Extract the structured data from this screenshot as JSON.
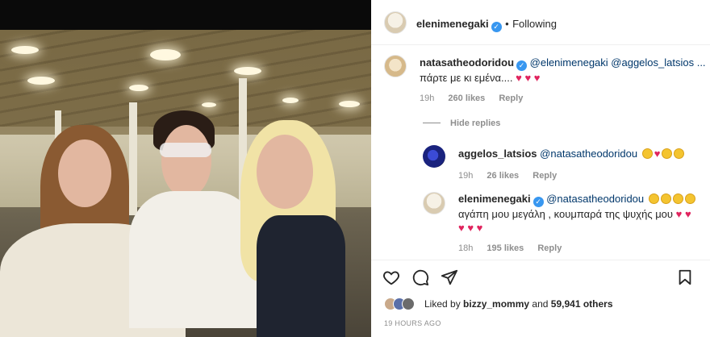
{
  "post": {
    "author": "elenimenegaki",
    "follow_separator": "•",
    "follow_status": "Following"
  },
  "comments": [
    {
      "username": "natasatheodoridou",
      "mentions": "@elenimenegaki @aggelos_latsios ...",
      "text": "πάρτε με κι εμένα....",
      "emoji": "♥ ♥ ♥",
      "time": "19h",
      "likes": "260 likes",
      "reply": "Reply"
    }
  ],
  "hide_replies": "Hide replies",
  "replies": [
    {
      "username": "aggelos_latsios",
      "mentions": "@natasatheodoridou",
      "time": "19h",
      "likes": "26 likes",
      "reply": "Reply"
    },
    {
      "username": "elenimenegaki",
      "mentions": "@natasatheodoridou",
      "text": "αγάπη μου μεγάλη , κουμπαρά της ψυχής μου",
      "emoji_line2": "♥ ♥ ♥",
      "emoji_end": "♥ ♥",
      "time": "18h",
      "likes": "195 likes",
      "reply": "Reply"
    }
  ],
  "likes_summary": {
    "prefix": "Liked by",
    "user": "bizzy_mommy",
    "middle": "and",
    "count": "59,941 others"
  },
  "time_ago": "19 HOURS AGO",
  "colors": {
    "heart": "#e0245e",
    "verified": "#3897f0",
    "mention": "#00376b"
  },
  "icons": [
    "heart-icon",
    "comment-icon",
    "share-icon",
    "bookmark-icon"
  ]
}
